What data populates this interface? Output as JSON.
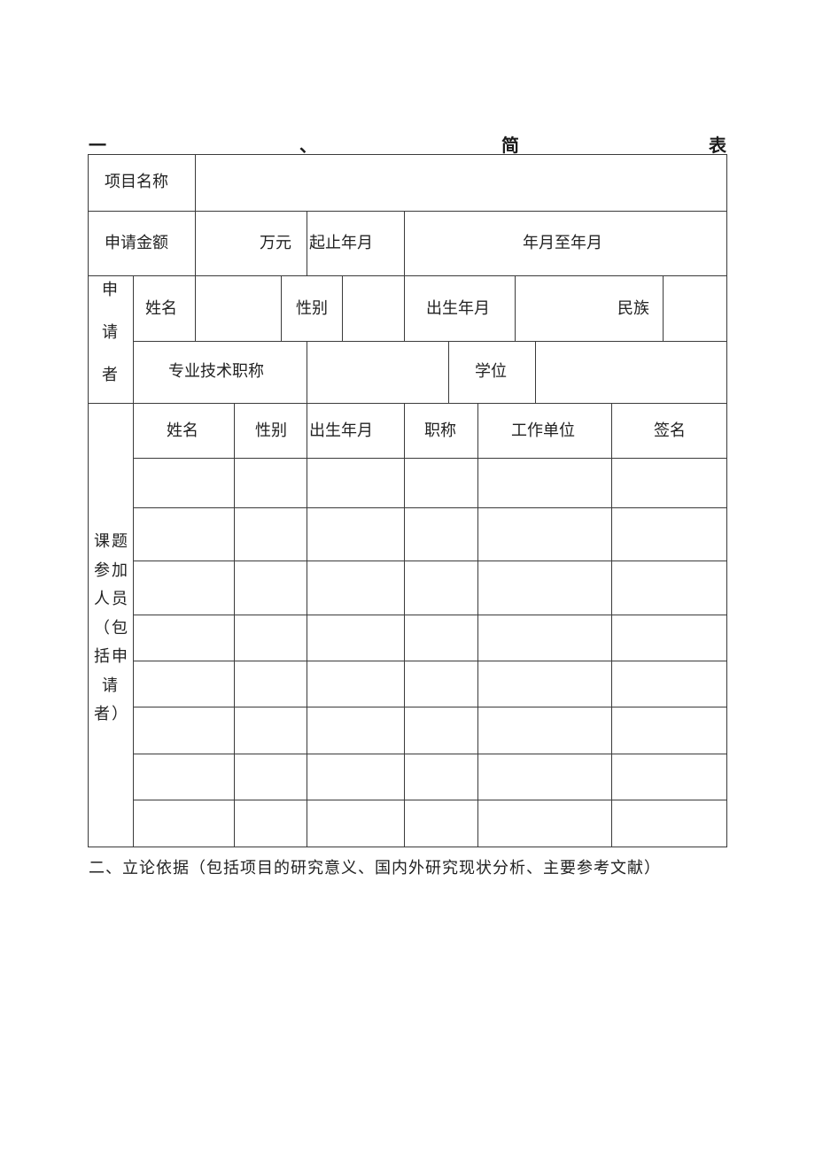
{
  "heading": {
    "parts": [
      "一",
      "、",
      "简",
      "表"
    ]
  },
  "row1": {
    "label": "项目名称",
    "value": ""
  },
  "row2": {
    "label": "申请金额",
    "amount_unit": "万元",
    "period_label": "起止年月",
    "period_value": "年月至年月"
  },
  "applicant": {
    "side_label": [
      "申",
      "请",
      "者"
    ],
    "name_label": "姓名",
    "gender_label": "性别",
    "birth_label": "出生年月",
    "ethnicity_label": "民族",
    "title_label": "专业技术职称",
    "degree_label": "学位"
  },
  "members": {
    "side_label_lines": [
      "课题",
      "参加",
      "人员",
      "（包",
      "括申",
      "请",
      "者）"
    ],
    "columns": [
      "姓名",
      "性别",
      "出生年月",
      "职称",
      "工作单位",
      "签名"
    ],
    "rows": [
      [
        "",
        "",
        "",
        "",
        "",
        ""
      ],
      [
        "",
        "",
        "",
        "",
        "",
        ""
      ],
      [
        "",
        "",
        "",
        "",
        "",
        ""
      ],
      [
        "",
        "",
        "",
        "",
        "",
        ""
      ],
      [
        "",
        "",
        "",
        "",
        "",
        ""
      ],
      [
        "",
        "",
        "",
        "",
        "",
        ""
      ],
      [
        "",
        "",
        "",
        "",
        "",
        ""
      ],
      [
        "",
        "",
        "",
        "",
        "",
        ""
      ]
    ]
  },
  "section2": {
    "title": "二、立论依据（包括项目的研究意义、国内外研究现状分析、主要参考文献）"
  }
}
